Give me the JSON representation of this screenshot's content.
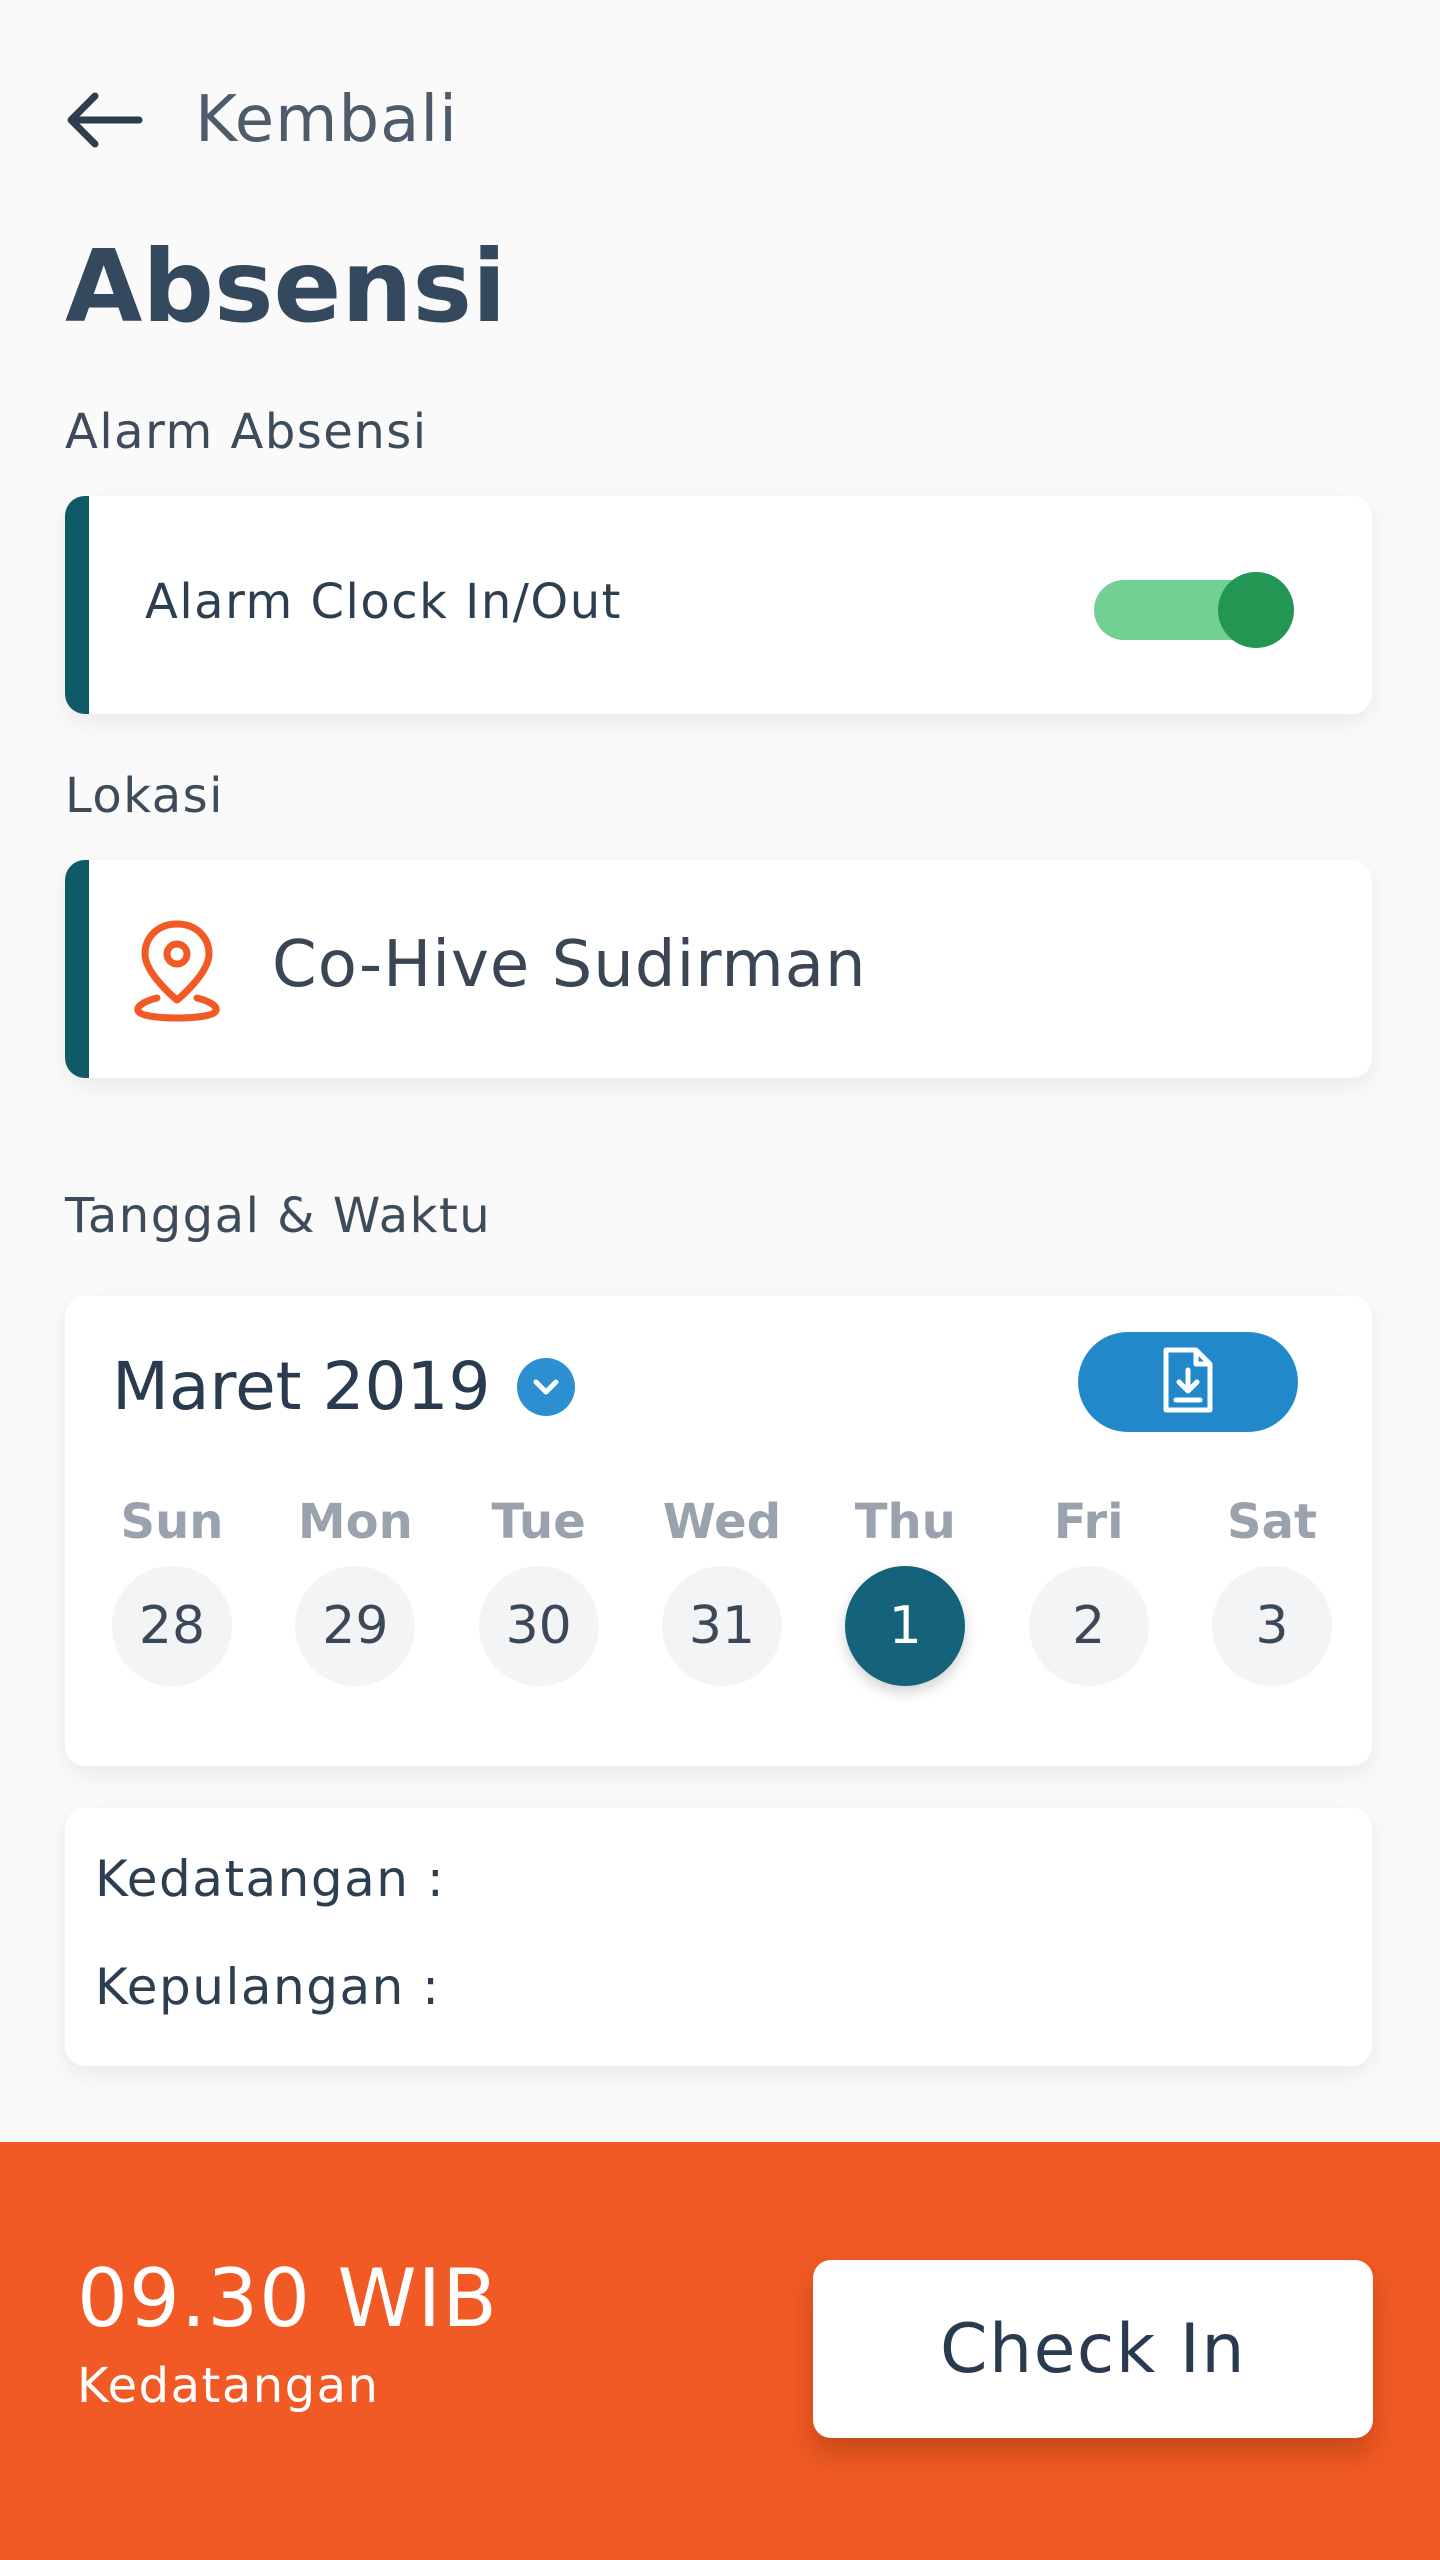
{
  "header": {
    "back_label": "Kembali",
    "back_icon": "arrow-left-icon",
    "title": "Absensi"
  },
  "alarm": {
    "section_label": "Alarm Absensi",
    "label": "Alarm Clock In/Out",
    "enabled": true
  },
  "location": {
    "section_label": "Lokasi",
    "icon": "map-pin-icon",
    "name": "Co-Hive Sudirman"
  },
  "datetime": {
    "section_label": "Tanggal & Waktu",
    "month_label": "Maret 2019",
    "days": [
      {
        "name": "Sun",
        "num": "28",
        "selected": false
      },
      {
        "name": "Mon",
        "num": "29",
        "selected": false
      },
      {
        "name": "Tue",
        "num": "30",
        "selected": false
      },
      {
        "name": "Wed",
        "num": "31",
        "selected": false
      },
      {
        "name": "Thu",
        "num": "1",
        "selected": true
      },
      {
        "name": "Fri",
        "num": "2",
        "selected": false
      },
      {
        "name": "Sat",
        "num": "3",
        "selected": false
      }
    ]
  },
  "times": {
    "arrival_label": "Kedatangan :",
    "departure_label": "Kepulangan :"
  },
  "bottom": {
    "time": "09.30 WIB",
    "sub_label": "Kedatangan",
    "button_label": "Check In"
  },
  "colors": {
    "accent_teal": "#0e5a66",
    "toggle_on": "#229652",
    "primary_blue": "#2188c9",
    "selected_day": "#15637a",
    "bottom_bar": "#f15a24",
    "pin_orange": "#f15a24"
  }
}
